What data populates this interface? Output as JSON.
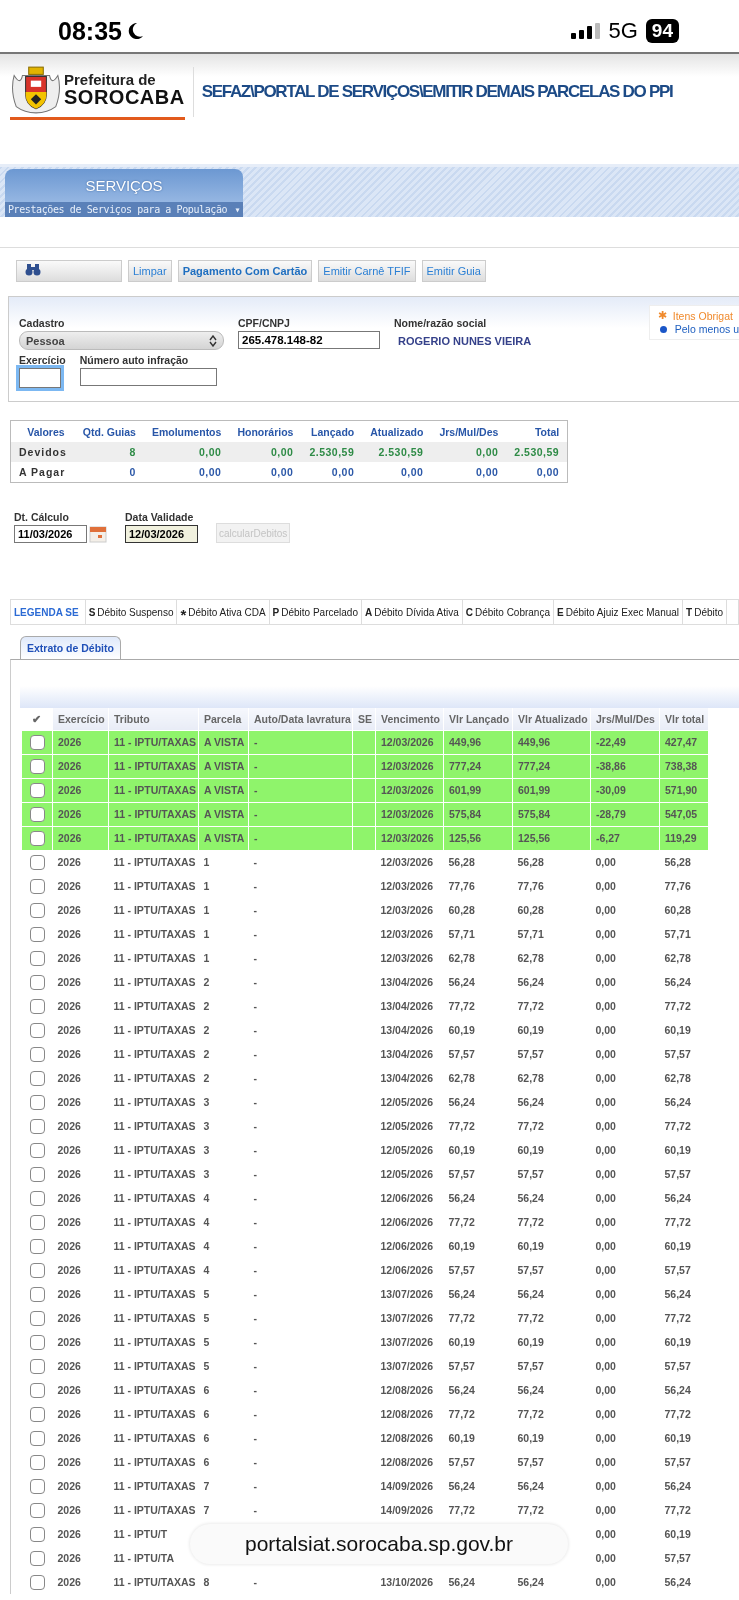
{
  "status_bar": {
    "time": "08:35",
    "network": "5G",
    "battery": "94"
  },
  "header": {
    "logo_line1": "Prefeitura de",
    "logo_line2": "SOROCABA",
    "breadcrumb": "SEFAZ\\PORTAL DE SERVIÇOS\\EMITIR DEMAIS PARCELAS DO PPI"
  },
  "menu": {
    "title": "SERVIÇOS",
    "subtitle": "Prestações de Serviços para a População",
    "caret": "▾"
  },
  "toolbar": [
    {
      "kind": "search"
    },
    {
      "kind": "plain",
      "label": "Limpar"
    },
    {
      "kind": "strong",
      "label": "Pagamento Com Cartão"
    },
    {
      "kind": "plain",
      "label": "Emitir Carnê TFIF"
    },
    {
      "kind": "plain",
      "label": "Emitir Guia"
    }
  ],
  "form": {
    "cadastro": {
      "label": "Cadastro",
      "value": "Pessoa"
    },
    "cpf": {
      "label": "CPF/CNPJ",
      "value": "265.478.148-82"
    },
    "nome": {
      "label": "Nome/razão social",
      "value": "ROGERIO NUNES VIEIRA"
    },
    "exercicio": {
      "label": "Exercício",
      "focused": true
    },
    "auto": {
      "label": "Número auto infração"
    },
    "hints": [
      {
        "kind": "required",
        "mark": "✱",
        "text": "Itens Obrigat"
      },
      {
        "kind": "atleast",
        "text": "Pelo menos u"
      }
    ]
  },
  "summary": {
    "columns": [
      "Valores",
      "Qtd. Guias",
      "Emolumentos",
      "Honorários",
      "Lançado",
      "Atualizado",
      "Jrs/Mul/Des",
      "Total"
    ],
    "rows": [
      {
        "kind": "due",
        "cells": [
          "Devidos",
          "8",
          "0,00",
          "0,00",
          "2.530,59",
          "2.530,59",
          "0,00",
          "2.530,59"
        ]
      },
      {
        "kind": "payable",
        "cells": [
          "A Pagar",
          "0",
          "0,00",
          "0,00",
          "0,00",
          "0,00",
          "0,00",
          "0,00"
        ]
      }
    ]
  },
  "dates": {
    "calc": {
      "label": "Dt. Cálculo",
      "value": "11/03/2026"
    },
    "validade": {
      "label": "Data Validade",
      "value": "12/03/2026"
    },
    "button": {
      "label": "calcularDebitos",
      "disabled": true
    }
  },
  "legend": {
    "title": "LEGENDA SE",
    "items": [
      {
        "code": "S",
        "label": "Débito Suspenso"
      },
      {
        "code": "*",
        "label": "Débito Ativa CDA"
      },
      {
        "code": "P",
        "label": "Débito Parcelado"
      },
      {
        "code": "A",
        "label": "Débito Dívida Ativa"
      },
      {
        "code": "C",
        "label": "Débito Cobrança"
      },
      {
        "code": "E",
        "label": "Débito Ajuiz Exec Manual"
      },
      {
        "code": "T",
        "label": "Débito"
      }
    ]
  },
  "tabs": [
    {
      "label": "Extrato de Débito",
      "selected": true
    }
  ],
  "table": {
    "select_all": "✔",
    "columns": [
      "Exercício",
      "Tributo",
      "Parcela",
      "Auto/Data lavratura",
      "SE",
      "Vencimento",
      "Vlr Lançado",
      "Vlr Atualizado",
      "Jrs/Mul/Des",
      "Vlr total"
    ],
    "rows": [
      {
        "highlighted": true,
        "checked": false,
        "exercicio": "2026",
        "tributo": "11 - IPTU/TAXAS",
        "parcela": "A VISTA",
        "auto": "-",
        "vencimento": "12/03/2026",
        "vlr_lancado": "449,96",
        "vlr_atualizado": "449,96",
        "jrs_mul_des": "-22,49",
        "vlr_total": "427,47"
      },
      {
        "highlighted": true,
        "checked": false,
        "exercicio": "2026",
        "tributo": "11 - IPTU/TAXAS",
        "parcela": "A VISTA",
        "auto": "-",
        "vencimento": "12/03/2026",
        "vlr_lancado": "777,24",
        "vlr_atualizado": "777,24",
        "jrs_mul_des": "-38,86",
        "vlr_total": "738,38"
      },
      {
        "highlighted": true,
        "checked": false,
        "exercicio": "2026",
        "tributo": "11 - IPTU/TAXAS",
        "parcela": "A VISTA",
        "auto": "-",
        "vencimento": "12/03/2026",
        "vlr_lancado": "601,99",
        "vlr_atualizado": "601,99",
        "jrs_mul_des": "-30,09",
        "vlr_total": "571,90"
      },
      {
        "highlighted": true,
        "checked": false,
        "exercicio": "2026",
        "tributo": "11 - IPTU/TAXAS",
        "parcela": "A VISTA",
        "auto": "-",
        "vencimento": "12/03/2026",
        "vlr_lancado": "575,84",
        "vlr_atualizado": "575,84",
        "jrs_mul_des": "-28,79",
        "vlr_total": "547,05"
      },
      {
        "highlighted": true,
        "checked": false,
        "exercicio": "2026",
        "tributo": "11 - IPTU/TAXAS",
        "parcela": "A VISTA",
        "auto": "-",
        "vencimento": "12/03/2026",
        "vlr_lancado": "125,56",
        "vlr_atualizado": "125,56",
        "jrs_mul_des": "-6,27",
        "vlr_total": "119,29"
      },
      {
        "highlighted": false,
        "checked": false,
        "exercicio": "2026",
        "tributo": "11 - IPTU/TAXAS",
        "parcela": "1",
        "auto": "-",
        "vencimento": "12/03/2026",
        "vlr_lancado": "56,28",
        "vlr_atualizado": "56,28",
        "jrs_mul_des": "0,00",
        "vlr_total": "56,28"
      },
      {
        "highlighted": false,
        "checked": false,
        "exercicio": "2026",
        "tributo": "11 - IPTU/TAXAS",
        "parcela": "1",
        "auto": "-",
        "vencimento": "12/03/2026",
        "vlr_lancado": "77,76",
        "vlr_atualizado": "77,76",
        "jrs_mul_des": "0,00",
        "vlr_total": "77,76"
      },
      {
        "highlighted": false,
        "checked": false,
        "exercicio": "2026",
        "tributo": "11 - IPTU/TAXAS",
        "parcela": "1",
        "auto": "-",
        "vencimento": "12/03/2026",
        "vlr_lancado": "60,28",
        "vlr_atualizado": "60,28",
        "jrs_mul_des": "0,00",
        "vlr_total": "60,28"
      },
      {
        "highlighted": false,
        "checked": false,
        "exercicio": "2026",
        "tributo": "11 - IPTU/TAXAS",
        "parcela": "1",
        "auto": "-",
        "vencimento": "12/03/2026",
        "vlr_lancado": "57,71",
        "vlr_atualizado": "57,71",
        "jrs_mul_des": "0,00",
        "vlr_total": "57,71"
      },
      {
        "highlighted": false,
        "checked": false,
        "exercicio": "2026",
        "tributo": "11 - IPTU/TAXAS",
        "parcela": "1",
        "auto": "-",
        "vencimento": "12/03/2026",
        "vlr_lancado": "62,78",
        "vlr_atualizado": "62,78",
        "jrs_mul_des": "0,00",
        "vlr_total": "62,78"
      },
      {
        "highlighted": false,
        "checked": false,
        "exercicio": "2026",
        "tributo": "11 - IPTU/TAXAS",
        "parcela": "2",
        "auto": "-",
        "vencimento": "13/04/2026",
        "vlr_lancado": "56,24",
        "vlr_atualizado": "56,24",
        "jrs_mul_des": "0,00",
        "vlr_total": "56,24"
      },
      {
        "highlighted": false,
        "checked": false,
        "exercicio": "2026",
        "tributo": "11 - IPTU/TAXAS",
        "parcela": "2",
        "auto": "-",
        "vencimento": "13/04/2026",
        "vlr_lancado": "77,72",
        "vlr_atualizado": "77,72",
        "jrs_mul_des": "0,00",
        "vlr_total": "77,72"
      },
      {
        "highlighted": false,
        "checked": false,
        "exercicio": "2026",
        "tributo": "11 - IPTU/TAXAS",
        "parcela": "2",
        "auto": "-",
        "vencimento": "13/04/2026",
        "vlr_lancado": "60,19",
        "vlr_atualizado": "60,19",
        "jrs_mul_des": "0,00",
        "vlr_total": "60,19"
      },
      {
        "highlighted": false,
        "checked": false,
        "exercicio": "2026",
        "tributo": "11 - IPTU/TAXAS",
        "parcela": "2",
        "auto": "-",
        "vencimento": "13/04/2026",
        "vlr_lancado": "57,57",
        "vlr_atualizado": "57,57",
        "jrs_mul_des": "0,00",
        "vlr_total": "57,57"
      },
      {
        "highlighted": false,
        "checked": false,
        "exercicio": "2026",
        "tributo": "11 - IPTU/TAXAS",
        "parcela": "2",
        "auto": "-",
        "vencimento": "13/04/2026",
        "vlr_lancado": "62,78",
        "vlr_atualizado": "62,78",
        "jrs_mul_des": "0,00",
        "vlr_total": "62,78"
      },
      {
        "highlighted": false,
        "checked": false,
        "exercicio": "2026",
        "tributo": "11 - IPTU/TAXAS",
        "parcela": "3",
        "auto": "-",
        "vencimento": "12/05/2026",
        "vlr_lancado": "56,24",
        "vlr_atualizado": "56,24",
        "jrs_mul_des": "0,00",
        "vlr_total": "56,24"
      },
      {
        "highlighted": false,
        "checked": false,
        "exercicio": "2026",
        "tributo": "11 - IPTU/TAXAS",
        "parcela": "3",
        "auto": "-",
        "vencimento": "12/05/2026",
        "vlr_lancado": "77,72",
        "vlr_atualizado": "77,72",
        "jrs_mul_des": "0,00",
        "vlr_total": "77,72"
      },
      {
        "highlighted": false,
        "checked": false,
        "exercicio": "2026",
        "tributo": "11 - IPTU/TAXAS",
        "parcela": "3",
        "auto": "-",
        "vencimento": "12/05/2026",
        "vlr_lancado": "60,19",
        "vlr_atualizado": "60,19",
        "jrs_mul_des": "0,00",
        "vlr_total": "60,19"
      },
      {
        "highlighted": false,
        "checked": false,
        "exercicio": "2026",
        "tributo": "11 - IPTU/TAXAS",
        "parcela": "3",
        "auto": "-",
        "vencimento": "12/05/2026",
        "vlr_lancado": "57,57",
        "vlr_atualizado": "57,57",
        "jrs_mul_des": "0,00",
        "vlr_total": "57,57"
      },
      {
        "highlighted": false,
        "checked": false,
        "exercicio": "2026",
        "tributo": "11 - IPTU/TAXAS",
        "parcela": "4",
        "auto": "-",
        "vencimento": "12/06/2026",
        "vlr_lancado": "56,24",
        "vlr_atualizado": "56,24",
        "jrs_mul_des": "0,00",
        "vlr_total": "56,24"
      },
      {
        "highlighted": false,
        "checked": false,
        "exercicio": "2026",
        "tributo": "11 - IPTU/TAXAS",
        "parcela": "4",
        "auto": "-",
        "vencimento": "12/06/2026",
        "vlr_lancado": "77,72",
        "vlr_atualizado": "77,72",
        "jrs_mul_des": "0,00",
        "vlr_total": "77,72"
      },
      {
        "highlighted": false,
        "checked": false,
        "exercicio": "2026",
        "tributo": "11 - IPTU/TAXAS",
        "parcela": "4",
        "auto": "-",
        "vencimento": "12/06/2026",
        "vlr_lancado": "60,19",
        "vlr_atualizado": "60,19",
        "jrs_mul_des": "0,00",
        "vlr_total": "60,19"
      },
      {
        "highlighted": false,
        "checked": false,
        "exercicio": "2026",
        "tributo": "11 - IPTU/TAXAS",
        "parcela": "4",
        "auto": "-",
        "vencimento": "12/06/2026",
        "vlr_lancado": "57,57",
        "vlr_atualizado": "57,57",
        "jrs_mul_des": "0,00",
        "vlr_total": "57,57"
      },
      {
        "highlighted": false,
        "checked": false,
        "exercicio": "2026",
        "tributo": "11 - IPTU/TAXAS",
        "parcela": "5",
        "auto": "-",
        "vencimento": "13/07/2026",
        "vlr_lancado": "56,24",
        "vlr_atualizado": "56,24",
        "jrs_mul_des": "0,00",
        "vlr_total": "56,24"
      },
      {
        "highlighted": false,
        "checked": false,
        "exercicio": "2026",
        "tributo": "11 - IPTU/TAXAS",
        "parcela": "5",
        "auto": "-",
        "vencimento": "13/07/2026",
        "vlr_lancado": "77,72",
        "vlr_atualizado": "77,72",
        "jrs_mul_des": "0,00",
        "vlr_total": "77,72"
      },
      {
        "highlighted": false,
        "checked": false,
        "exercicio": "2026",
        "tributo": "11 - IPTU/TAXAS",
        "parcela": "5",
        "auto": "-",
        "vencimento": "13/07/2026",
        "vlr_lancado": "60,19",
        "vlr_atualizado": "60,19",
        "jrs_mul_des": "0,00",
        "vlr_total": "60,19"
      },
      {
        "highlighted": false,
        "checked": false,
        "exercicio": "2026",
        "tributo": "11 - IPTU/TAXAS",
        "parcela": "5",
        "auto": "-",
        "vencimento": "13/07/2026",
        "vlr_lancado": "57,57",
        "vlr_atualizado": "57,57",
        "jrs_mul_des": "0,00",
        "vlr_total": "57,57"
      },
      {
        "highlighted": false,
        "checked": false,
        "exercicio": "2026",
        "tributo": "11 - IPTU/TAXAS",
        "parcela": "6",
        "auto": "-",
        "vencimento": "12/08/2026",
        "vlr_lancado": "56,24",
        "vlr_atualizado": "56,24",
        "jrs_mul_des": "0,00",
        "vlr_total": "56,24"
      },
      {
        "highlighted": false,
        "checked": false,
        "exercicio": "2026",
        "tributo": "11 - IPTU/TAXAS",
        "parcela": "6",
        "auto": "-",
        "vencimento": "12/08/2026",
        "vlr_lancado": "77,72",
        "vlr_atualizado": "77,72",
        "jrs_mul_des": "0,00",
        "vlr_total": "77,72"
      },
      {
        "highlighted": false,
        "checked": false,
        "exercicio": "2026",
        "tributo": "11 - IPTU/TAXAS",
        "parcela": "6",
        "auto": "-",
        "vencimento": "12/08/2026",
        "vlr_lancado": "60,19",
        "vlr_atualizado": "60,19",
        "jrs_mul_des": "0,00",
        "vlr_total": "60,19"
      },
      {
        "highlighted": false,
        "checked": false,
        "exercicio": "2026",
        "tributo": "11 - IPTU/TAXAS",
        "parcela": "6",
        "auto": "-",
        "vencimento": "12/08/2026",
        "vlr_lancado": "57,57",
        "vlr_atualizado": "57,57",
        "jrs_mul_des": "0,00",
        "vlr_total": "57,57"
      },
      {
        "highlighted": false,
        "checked": false,
        "exercicio": "2026",
        "tributo": "11 - IPTU/TAXAS",
        "parcela": "7",
        "auto": "-",
        "vencimento": "14/09/2026",
        "vlr_lancado": "56,24",
        "vlr_atualizado": "56,24",
        "jrs_mul_des": "0,00",
        "vlr_total": "56,24"
      },
      {
        "highlighted": false,
        "checked": false,
        "exercicio": "2026",
        "tributo": "11 - IPTU/TAXAS",
        "parcela": "7",
        "auto": "-",
        "vencimento": "14/09/2026",
        "vlr_lancado": "77,72",
        "vlr_atualizado": "77,72",
        "jrs_mul_des": "0,00",
        "vlr_total": "77,72"
      },
      {
        "highlighted": false,
        "checked": false,
        "exercicio": "2026",
        "tributo": "11 - IPTU/T",
        "jrs_mul_des": "0,00",
        "vlr_total": "60,19"
      },
      {
        "highlighted": false,
        "checked": false,
        "exercicio": "2026",
        "tributo": "11 - IPTU/TA",
        "jrs_mul_des": "0,00",
        "vlr_total": "57,57"
      },
      {
        "highlighted": false,
        "checked": false,
        "exercicio": "2026",
        "tributo": "11 - IPTU/TAXAS",
        "parcela": "8",
        "auto": "-",
        "vencimento": "13/10/2026",
        "vlr_lancado": "56,24",
        "vlr_atualizado": "56,24",
        "jrs_mul_des": "0,00",
        "vlr_total": "56,24"
      }
    ]
  },
  "browser_bar": {
    "url": "portalsiat.sorocaba.sp.gov.br"
  }
}
